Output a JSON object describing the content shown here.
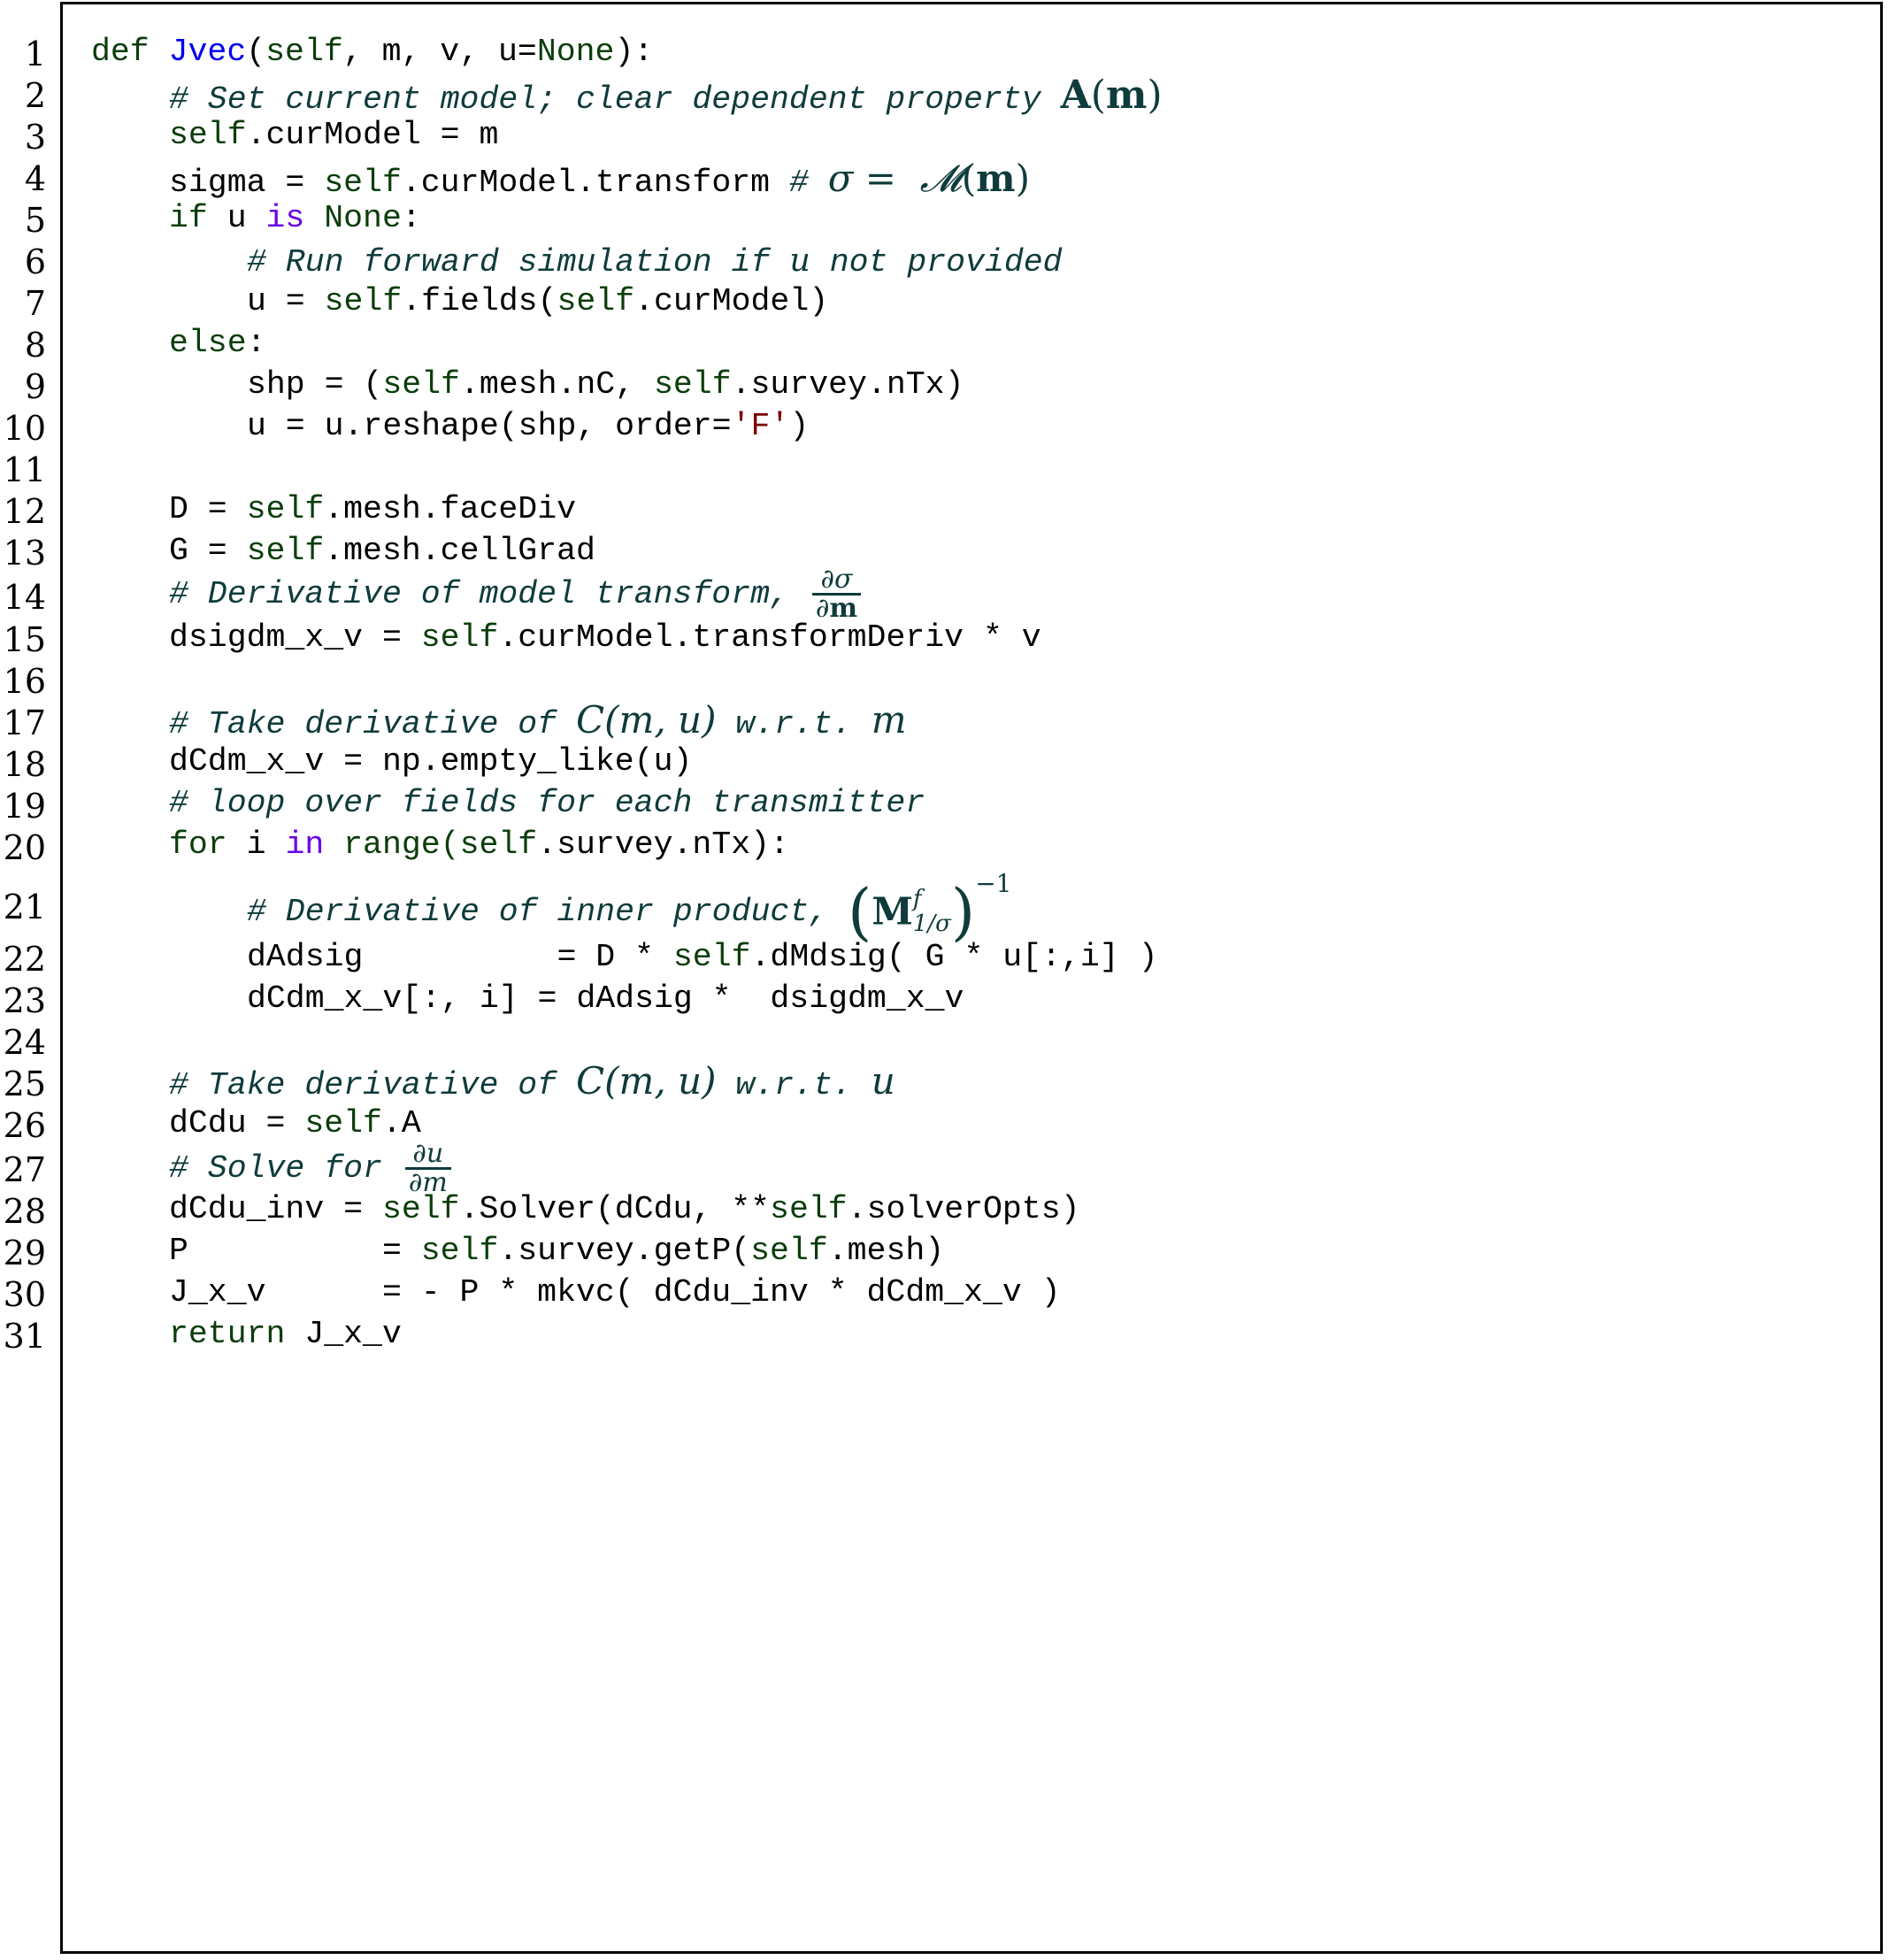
{
  "listing": {
    "function_name": "Jvec",
    "line_numbers": [
      "1",
      "2",
      "3",
      "4",
      "5",
      "6",
      "7",
      "8",
      "9",
      "10",
      "11",
      "12",
      "13",
      "14",
      "15",
      "16",
      "17",
      "18",
      "19",
      "20",
      "21",
      "22",
      "23",
      "24",
      "25",
      "26",
      "27",
      "28",
      "29",
      "30",
      "31"
    ],
    "lines": {
      "l1": {
        "def": "def ",
        "name": "Jvec",
        "p1": "(",
        "self": "self",
        "rest1": ", m, v, u=",
        "none": "None",
        "rest2": "):"
      },
      "l2": {
        "comment": "# Set current model; clear dependent property ",
        "math_A": "A",
        "math_lp": "(",
        "math_m": "m",
        "math_rp": ")"
      },
      "l3": {
        "self": "self",
        "rest": ".curModel = m"
      },
      "l4": {
        "pre": "sigma = ",
        "self": "self",
        "rest": ".curModel.transform ",
        "hash": "# ",
        "sigma": "σ",
        "eq": " = ",
        "calM": "𝓜",
        "lp": "(",
        "m": "m",
        "rp": ")"
      },
      "l5": {
        "if": "if",
        "u": " u ",
        "is": "is",
        "sp": " ",
        "none": "None",
        "colon": ":"
      },
      "l6": {
        "comment1": "# Run forward simulation if ",
        "u": "u",
        "comment2": " not provided"
      },
      "l7": {
        "pre": "u = ",
        "self1": "self",
        "mid": ".fields(",
        "self2": "self",
        "rest": ".curModel)"
      },
      "l8": {
        "else": "else",
        "colon": ":"
      },
      "l9": {
        "pre": "shp = (",
        "self1": "self",
        "mid": ".mesh.nC, ",
        "self2": "self",
        "rest": ".survey.nTx)"
      },
      "l10": {
        "pre": "u = u.reshape(shp, order=",
        "str": "'F'",
        "rest": ")"
      },
      "l11": {
        "text": ""
      },
      "l12": {
        "pre": "D = ",
        "self": "self",
        "rest": ".mesh.faceDiv"
      },
      "l13": {
        "pre": "G = ",
        "self": "self",
        "rest": ".mesh.cellGrad"
      },
      "l14": {
        "comment": "# Derivative of model transform, ",
        "num": "∂σ",
        "den_d": "∂",
        "den_m": "m"
      },
      "l15": {
        "pre": "dsigdm_x_v = ",
        "self": "self",
        "rest": ".curModel.transformDeriv * v"
      },
      "l16": {
        "text": ""
      },
      "l17": {
        "comment": "# Take derivative of ",
        "C": "C",
        "args": "(m, u)",
        "wrt": " w.r.t. ",
        "var": "m"
      },
      "l18": {
        "text": "dCdm_x_v = np.empty_like(u)"
      },
      "l19": {
        "comment": "# loop over fields for each transmitter"
      },
      "l20": {
        "for": "for",
        "i": " i ",
        "in": "in",
        "sp": " ",
        "range": "range(",
        "self": "self",
        "rest": ".survey.nTx):"
      },
      "l21": {
        "comment": "# Derivative of inner product, ",
        "M": "M",
        "sup_f": "f",
        "sub": "1/σ",
        "exp": "−1"
      },
      "l22": {
        "pre": "dAdsig          = D * ",
        "self": "self",
        "rest": ".dMdsig( G * u[:,i] )"
      },
      "l23": {
        "text": "dCdm_x_v[:, i] = dAdsig *  dsigdm_x_v"
      },
      "l24": {
        "text": ""
      },
      "l25": {
        "comment": "# Take derivative of ",
        "C": "C",
        "args": "(m, u)",
        "wrt": " w.r.t. ",
        "var": "u"
      },
      "l26": {
        "pre": "dCdu = ",
        "self": "self",
        "rest": ".A"
      },
      "l27": {
        "comment": "# Solve for ",
        "num": "∂u",
        "den": "∂m"
      },
      "l28": {
        "pre": "dCdu_inv = ",
        "self1": "self",
        "mid": ".Solver(dCdu, **",
        "self2": "self",
        "rest": ".solverOpts)"
      },
      "l29": {
        "pre": "P          = ",
        "self1": "self",
        "mid": ".survey.getP(",
        "self2": "self",
        "rest": ".mesh)"
      },
      "l30": {
        "text": "J_x_v      = - P * mkvc( dCdu_inv * dCdm_x_v )"
      },
      "l31": {
        "ret": "return",
        "rest": " J_x_v"
      }
    }
  },
  "colors": {
    "keyword": "#0b3d0b",
    "function_name": "#0000ee",
    "operator_keyword": "#6a00e6",
    "string": "#7a0000",
    "comment": "#0f3b3b",
    "text": "#000000",
    "border": "#000000"
  }
}
